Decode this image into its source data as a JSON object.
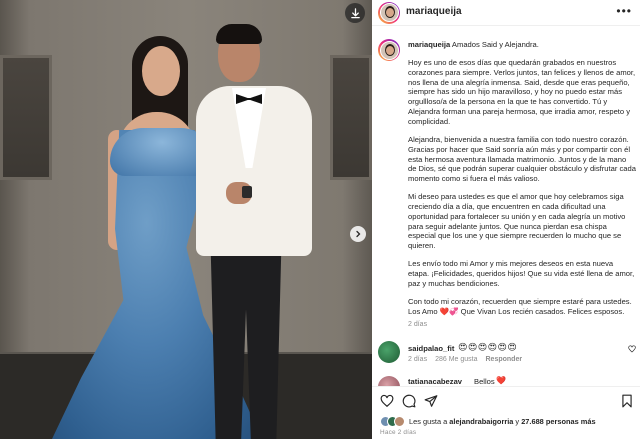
{
  "post": {
    "username": "mariaqueija",
    "more_label": "•••",
    "caption": {
      "username": "mariaqueija",
      "headline": "Amados Said y Alejandra.",
      "paragraphs": [
        "Hoy es uno de esos días que quedarán grabados en nuestros corazones para siempre. Verlos juntos, tan felices y llenos de amor, nos llena de una alegría inmensa. Said, desde que eras pequeño, siempre has sido un hijo maravilloso, y hoy no puedo estar más orgullloso/a de la persona en la que te has convertido. Tú y Alejandra forman una pareja hermosa, que irradia amor, respeto y complicidad.",
        "Alejandra, bienvenida a nuestra familia con todo nuestro corazón. Gracias por hacer que Said sonría aún más y por compartir con él esta hermosa aventura llamada matrimonio. Juntos y de la mano de Dios, sé que podrán superar cualquier obstáculo y disfrutar cada momento como si fuera el más valioso.",
        "Mi deseo para ustedes es que el amor que hoy celebramos siga creciendo día a día, que encuentren en cada dificultad una oportunidad para fortalecer su unión y en cada alegría un motivo para seguir adelante juntos. Que nunca pierdan esa chispa especial que los une y que siempre recuerden lo mucho que se quieren.",
        "Les envío todo mi Amor y mis mejores deseos en esta nueva etapa. ¡Felicidades, queridos hijos! Que su vida esté llena de amor, paz y muchas bendiciones.",
        "Con todo mi corazón, recuerden que siempre estaré para ustedes. Los Amo ❤️💞 Que Vivan Los recién casados. Felices esposos."
      ],
      "time": "2 días"
    },
    "comments": [
      {
        "username": "saidpalao_fit",
        "text": "😍😍😍😍😍😍",
        "time": "2 días",
        "likes": "286 Me gusta",
        "reply": "Responder",
        "like_icon": "heart-outline-icon"
      },
      {
        "username": "tatianacabezav",
        "text": "Bellos",
        "emoji": "❤️"
      }
    ],
    "likes": {
      "prefix": "Les gusta a",
      "user": "alejandrabaigorria",
      "connector": "y",
      "others": "27.688 personas más"
    },
    "timestamp": "Hace 2 días"
  },
  "media_controls": {
    "download_icon": "download-icon",
    "next_icon": "chevron-right-icon"
  },
  "action_icons": [
    "heart-icon",
    "comment-icon",
    "share-icon",
    "bookmark-icon"
  ],
  "colors": {
    "text": "#262626",
    "muted": "#8e8e8e",
    "divider": "#efefef",
    "like_red": "#ed4956",
    "gown_blue": "#4c7fb0"
  }
}
